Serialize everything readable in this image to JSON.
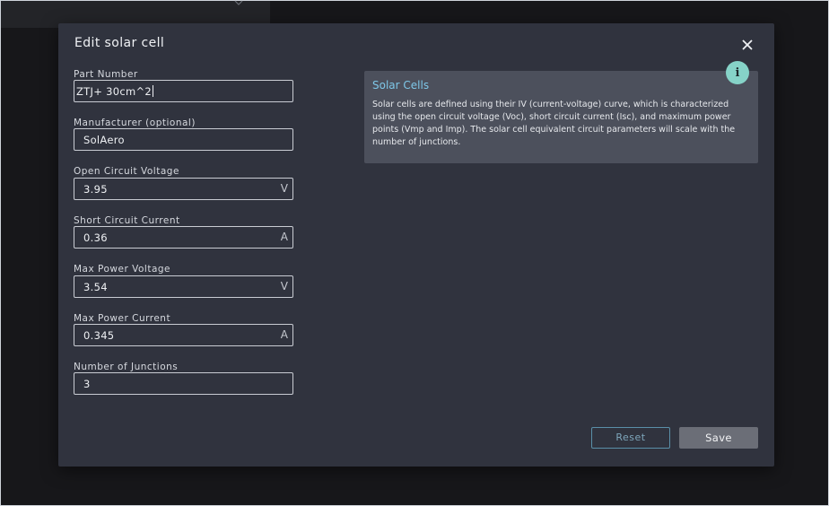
{
  "dialog": {
    "title": "Edit solar cell",
    "fields": [
      {
        "label": "Part Number",
        "value": "ZTJ+ 30cm^2",
        "unit": ""
      },
      {
        "label": "Manufacturer (optional)",
        "value": "SolAero",
        "unit": ""
      },
      {
        "label": "Open Circuit Voltage",
        "value": "3.95",
        "unit": "V"
      },
      {
        "label": "Short Circuit Current",
        "value": "0.36",
        "unit": "A"
      },
      {
        "label": "Max Power Voltage",
        "value": "3.54",
        "unit": "V"
      },
      {
        "label": "Max Power Current",
        "value": "0.345",
        "unit": "A"
      },
      {
        "label": "Number of Junctions",
        "value": "3",
        "unit": ""
      }
    ],
    "info": {
      "title": "Solar Cells",
      "text": "Solar cells are defined using their IV (current-voltage) curve, which is characterized using the open circuit voltage (Voc), short circuit current (Isc), and maximum power points (Vmp and Imp). The solar cell equivalent circuit parameters will scale with the number of junctions.",
      "icon": "info-icon",
      "icon_glyph": "i"
    },
    "buttons": {
      "reset_label": "Reset",
      "save_label": "Save"
    }
  },
  "colors": {
    "dialog_bg": "#30333e",
    "info_card_bg": "#4c505c",
    "accent": "#7ec7e8",
    "badge": "#86d3c8",
    "save_button": "#6b6e77"
  }
}
